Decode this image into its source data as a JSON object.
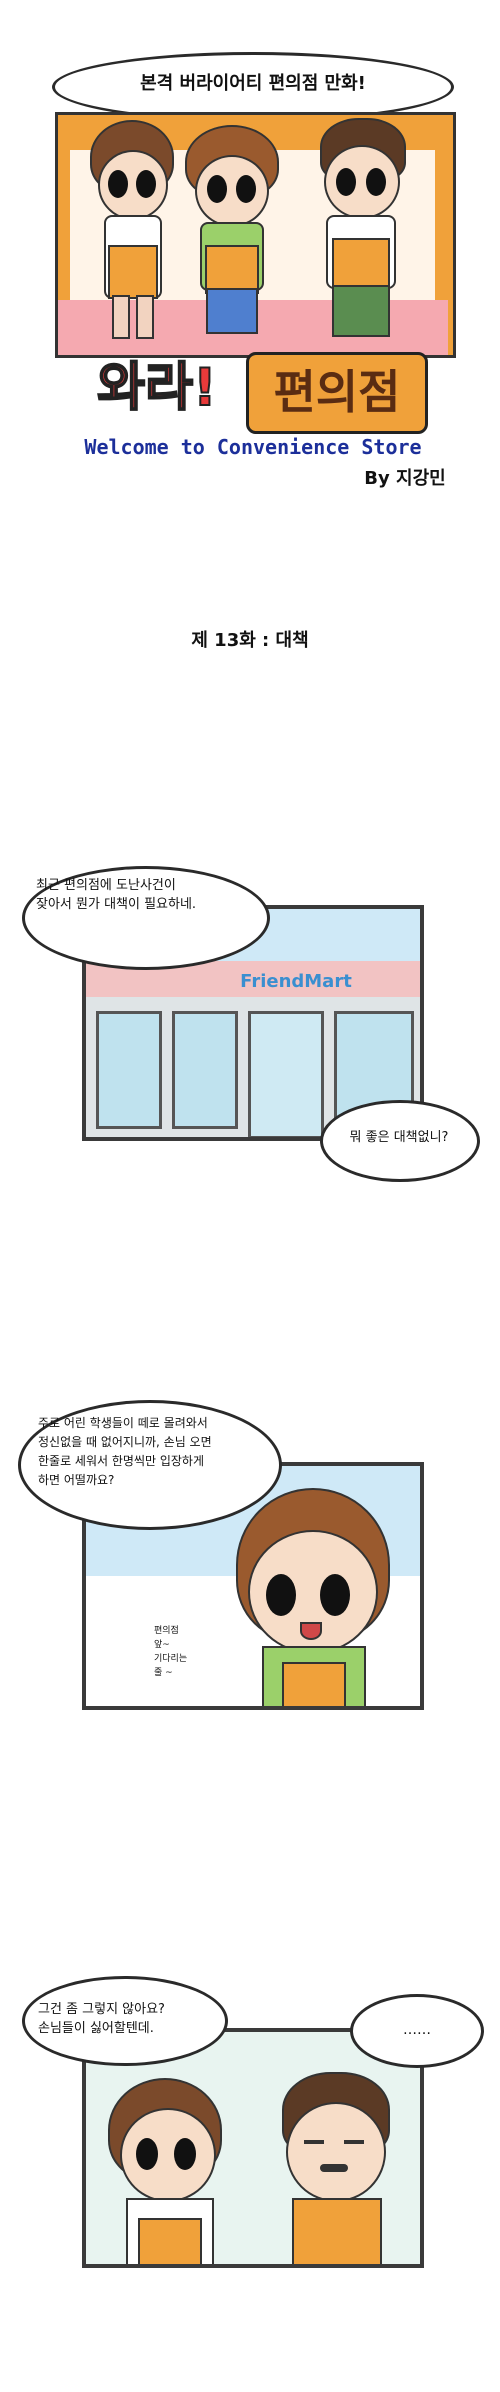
{
  "cover": {
    "tagline": "본격 버라이어티 편의점 만화!",
    "title_part1": "와라!",
    "title_part2": "편의점",
    "subtitle": "Welcome to Convenience Store",
    "author": "By 지강민"
  },
  "episode": {
    "title": "제 13화 : 대책"
  },
  "panel1": {
    "bubble1": "최근 편의점에 도난사건이\n잦아서 뭔가 대책이 필요하네.",
    "sign": "FriendMart",
    "bubble2": "뭐 좋은 대책없니?"
  },
  "panel2": {
    "bubble": "주로 어린 학생들이 떼로 몰려와서\n정신없을 때 없어지니까, 손님 오면\n한줄로 세워서 한명씩만 입장하게\n하면 어떨까요?",
    "aside": "편의점\n앞~\n기다리는\n줄 ~"
  },
  "panel3": {
    "bubble1": "그건 좀 그렇지 않아요?\n손님들이 싫어할텐데.",
    "bubble2": "……"
  },
  "colors": {
    "accent": "#f0a13a",
    "brand_red": "#e83a3a",
    "sky": "#cfe9f7"
  }
}
